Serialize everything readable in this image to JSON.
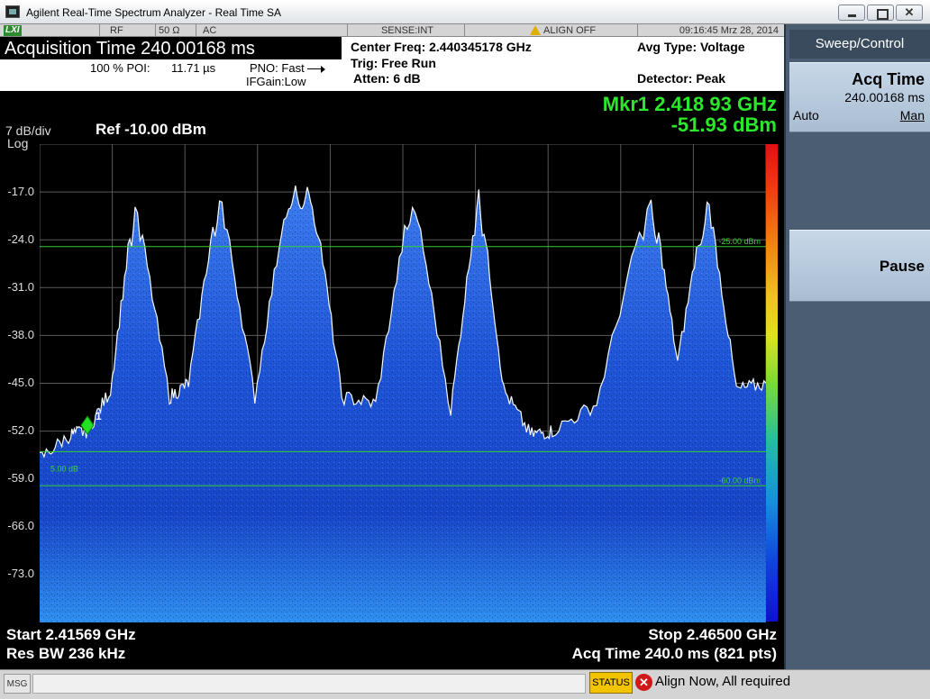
{
  "window": {
    "title": "Agilent Real-Time Spectrum Analyzer - Real Time SA"
  },
  "status_strip": {
    "lxi": "LXI",
    "rf": "RF",
    "impedance": "50 Ω",
    "coupling": "AC",
    "sense": "SENSE:INT",
    "align": "ALIGN OFF",
    "datetime": "09:16:45  Mrz 28, 2014"
  },
  "info": {
    "acq_title": "Acquisition Time 240.00168 ms",
    "poi_label": "100 % POI:",
    "poi_value": "11.71 µs",
    "pno": "PNO: Fast",
    "ifgain": "IFGain:Low",
    "center_freq": "Center Freq: 2.440345178 GHz",
    "trig": "Trig: Free Run",
    "atten": "Atten: 6 dB",
    "avg_type": "Avg Type: Voltage",
    "detector": "Detector: Peak"
  },
  "marker": {
    "freq": "Mkr1 2.418 93 GHz",
    "level": "-51.93 dBm",
    "label": "1"
  },
  "scale": {
    "per_div": "7 dB/div",
    "log": "Log",
    "ref": "Ref -10.00 dBm"
  },
  "y_ticks": [
    "-17.0",
    "-24.0",
    "-31.0",
    "-38.0",
    "-45.0",
    "-52.0",
    "-59.0",
    "-66.0",
    "-73.0"
  ],
  "lines": {
    "upper_label": "-25.00 dBm",
    "lower_label": "-60.00 dBm",
    "left_label": "5.00 dB"
  },
  "bottom": {
    "start": "Start 2.41569 GHz",
    "rbw": "Res BW 236 kHz",
    "stop": "Stop 2.46500 GHz",
    "acq": "Acq Time   240.0 ms (821 pts)"
  },
  "softkeys": {
    "header": "Sweep/Control",
    "acq_title": "Acq Time",
    "acq_value": "240.00168 ms",
    "acq_auto": "Auto",
    "acq_man": "Man",
    "pause": "Pause"
  },
  "msgbar": {
    "msg_label": "MSG",
    "status_btn": "STATUS",
    "status_msg": "Align Now, All required"
  },
  "chart_data": {
    "type": "line",
    "ylabel": "dBm",
    "ylim": [
      -80,
      -10
    ],
    "xlim": [
      2.41569,
      2.465
    ],
    "x": [
      2.41569,
      2.4178,
      2.41893,
      2.4205,
      2.42217,
      2.4245,
      2.4258,
      2.4279,
      2.4303,
      2.4326,
      2.4342,
      2.4362,
      2.4385,
      2.441,
      2.4436,
      2.4455,
      2.4472,
      2.449,
      2.4505,
      2.4535,
      2.4572,
      2.459,
      2.461,
      2.463,
      2.465
    ],
    "values": [
      -56,
      -52.5,
      -51.93,
      -46,
      -17.5,
      -47,
      -45,
      -16,
      -47,
      -16,
      -16,
      -47,
      -48,
      -16,
      -49,
      -16,
      -46,
      -52.5,
      -52,
      -48,
      -16,
      -42,
      -16.5,
      -46,
      -45
    ],
    "reference_lines": [
      -25.0,
      -55.0,
      -60.0
    ],
    "marker": {
      "x": 2.41893,
      "y": -51.93
    }
  }
}
